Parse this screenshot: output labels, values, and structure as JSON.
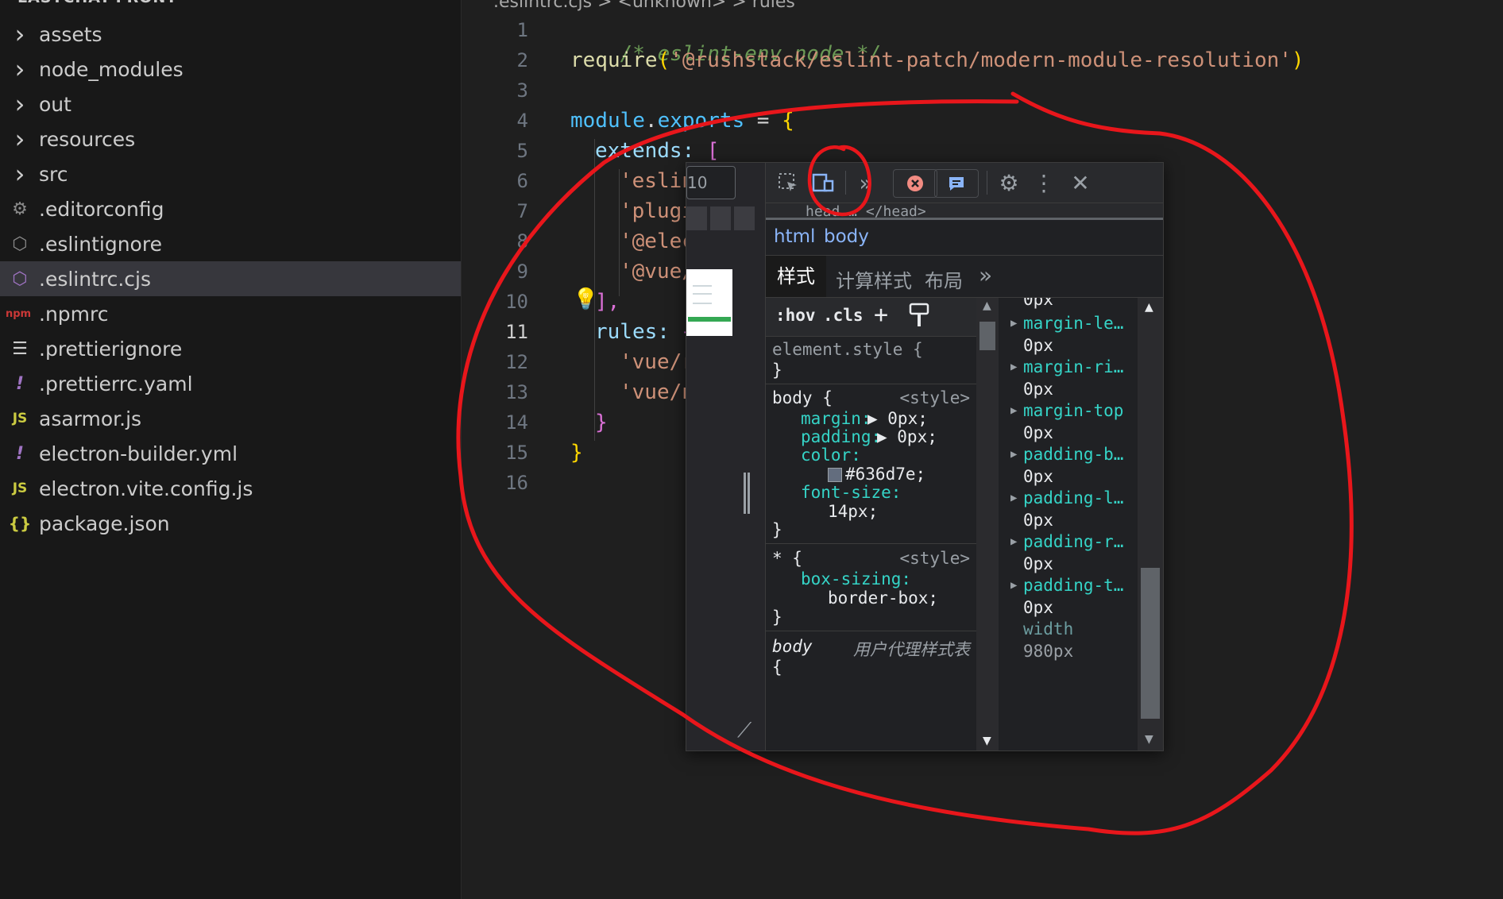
{
  "sidebar": {
    "project_title": "LASTCHAT-FRONT",
    "items": [
      {
        "label": "assets",
        "icon": "chevron-right-icon",
        "glyph": "›",
        "color": "#cccccc"
      },
      {
        "label": "node_modules",
        "icon": "chevron-right-icon",
        "glyph": "›",
        "color": "#cccccc"
      },
      {
        "label": "out",
        "icon": "chevron-right-icon",
        "glyph": "›",
        "color": "#cccccc"
      },
      {
        "label": "resources",
        "icon": "chevron-right-icon",
        "glyph": "›",
        "color": "#cccccc"
      },
      {
        "label": "src",
        "icon": "chevron-right-icon",
        "glyph": "›",
        "color": "#cccccc"
      },
      {
        "label": ".editorconfig",
        "icon": "gear-icon",
        "glyph": "⚙",
        "color": "#8a8a8a"
      },
      {
        "label": ".eslintignore",
        "icon": "eslint-icon",
        "glyph": "⬡",
        "color": "#8a8a8a"
      },
      {
        "label": ".eslintrc.cjs",
        "icon": "eslint-icon",
        "glyph": "⬡",
        "color": "#a074c4",
        "selected": true
      },
      {
        "label": ".npmrc",
        "icon": "npm-icon",
        "glyph": "npm",
        "color": "#cb3837"
      },
      {
        "label": ".prettierignore",
        "icon": "lines-icon",
        "glyph": "☰",
        "color": "#cccccc"
      },
      {
        "label": ".prettierrc.yaml",
        "icon": "exclamation-icon",
        "glyph": "!",
        "color": "#a074c4"
      },
      {
        "label": "asarmor.js",
        "icon": "js-icon",
        "glyph": "JS",
        "color": "#cbcb41"
      },
      {
        "label": "electron-builder.yml",
        "icon": "exclamation-icon",
        "glyph": "!",
        "color": "#a074c4"
      },
      {
        "label": "electron.vite.config.js",
        "icon": "js-icon",
        "glyph": "JS",
        "color": "#cbcb41"
      },
      {
        "label": "package.json",
        "icon": "braces-icon",
        "glyph": "{}",
        "color": "#cbcb41"
      }
    ]
  },
  "editor": {
    "breadcrumb": ".eslintrc.cjs > <unknown> > rules",
    "active_line": "11",
    "line_numbers": [
      "1",
      "2",
      "3",
      "4",
      "5",
      "6",
      "7",
      "8",
      "9",
      "10",
      "11",
      "12",
      "13",
      "14",
      "15",
      "16"
    ],
    "lines": {
      "l1": "/* eslint-env node */",
      "l2_fn": "require",
      "l2_open": "(",
      "l2_str": "'@rushstack/eslint-patch/modern-module-resolution'",
      "l2_close": ")",
      "l4_obj": "module",
      "l4_dot": ".",
      "l4_prop": "exports",
      "l4_eq": " = ",
      "l4_brace": "{",
      "l5_key": "extends:",
      "l5_br": " [",
      "l6": "'eslin",
      "l7": "'plugi",
      "l8": "'@elec",
      "l9": "'@vue/",
      "l10": "],",
      "l11_key": "rules:",
      "l11_br": " {",
      "l12": "'vue/r",
      "l13": "'vue/n",
      "l14": "}",
      "l15": "}"
    }
  },
  "devtools": {
    "zoom": "10",
    "toolbar": {
      "inspect": "inspect-element-icon",
      "device": "device-toolbar-icon",
      "more_tabs": "»",
      "settings": "gear-icon",
      "kebab": "⋮",
      "close": "✕"
    },
    "crumb_strip": "head … </head>",
    "node_tabs": [
      "html",
      "body"
    ],
    "panel_tabs": [
      "样式",
      "计算样式",
      "布局",
      "»"
    ],
    "filter": {
      "hov": ":hov",
      "cls": ".cls",
      "add": "+"
    },
    "styles": {
      "element_style": {
        "selector": "element.style {",
        "close": "}"
      },
      "body_rule": {
        "selector": "body {",
        "source": "<style>",
        "props": [
          {
            "name": "margin:",
            "value": "▶ 0px;"
          },
          {
            "name": "padding:",
            "value": "▶ 0px;"
          },
          {
            "name": "color:",
            "value": "#636d7e;"
          },
          {
            "name": "font-size:",
            "value": "14px;"
          }
        ],
        "close": "}"
      },
      "star_rule": {
        "selector": "* {",
        "source": "<style>",
        "props": [
          {
            "name": "box-sizing:",
            "value": "border-box;"
          }
        ],
        "close": "}"
      },
      "ua_rule": {
        "selector": "body",
        "source": "用户代理样式表",
        "open": "{"
      }
    },
    "computed": [
      {
        "name": "0px",
        "value": "",
        "partial": true
      },
      {
        "name": "margin-le…",
        "value": "0px"
      },
      {
        "name": "margin-ri…",
        "value": "0px"
      },
      {
        "name": "margin-top",
        "value": "0px"
      },
      {
        "name": "padding-b…",
        "value": "0px"
      },
      {
        "name": "padding-l…",
        "value": "0px"
      },
      {
        "name": "padding-r…",
        "value": "0px"
      },
      {
        "name": "padding-t…",
        "value": "0px"
      },
      {
        "name": "width",
        "value": "980px",
        "dim": true
      }
    ]
  },
  "colors": {
    "annotation": "#e8161b",
    "swatch": "#636d7e",
    "accent_link": "#8ab4f8",
    "error_badge": "#f28b82"
  }
}
